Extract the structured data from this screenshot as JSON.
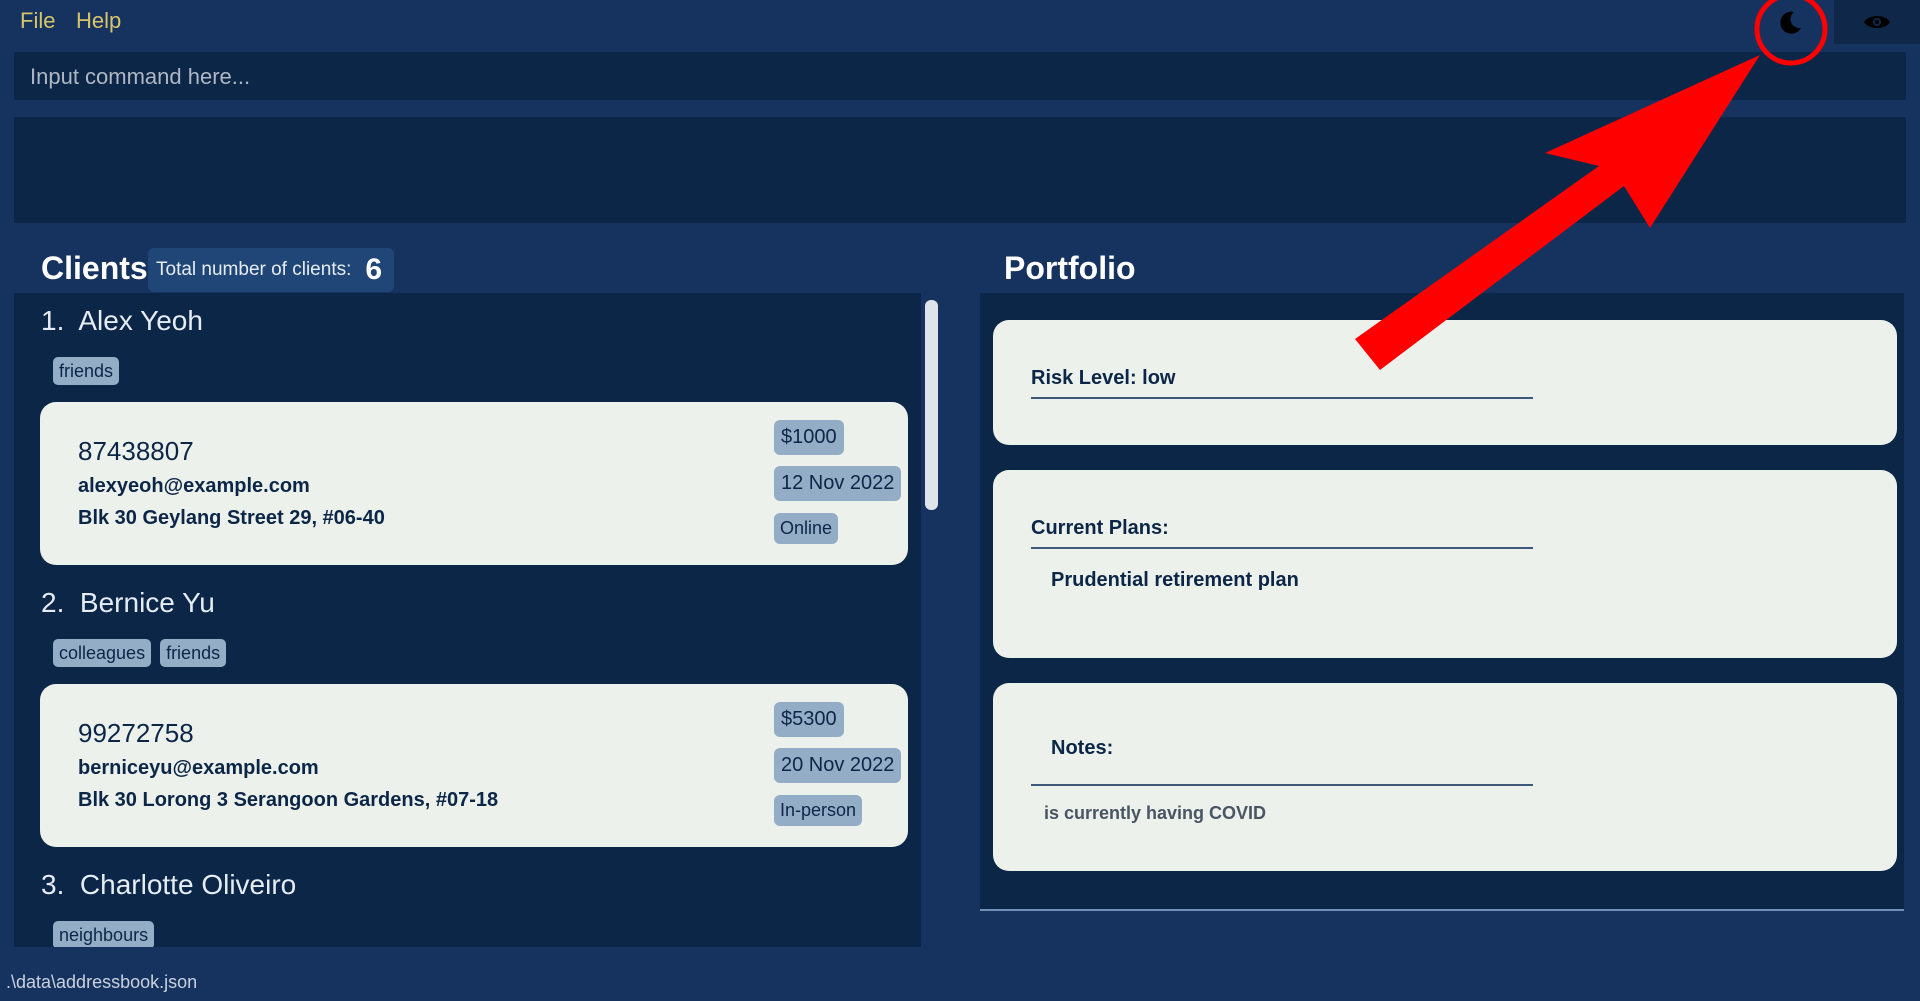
{
  "menu": {
    "file": "File",
    "help": "Help"
  },
  "toolbar": {
    "theme_icon": "moon-icon",
    "eye_icon": "eye-icon"
  },
  "command": {
    "placeholder": "Input command here..."
  },
  "clients": {
    "title": "Clients",
    "count_label": "Total number of clients:",
    "count": "6",
    "items": [
      {
        "index": "1.",
        "name": "Alex Yeoh",
        "tags": [
          "friends"
        ],
        "phone": "87438807",
        "email": "alexyeoh@example.com",
        "address": "Blk 30 Geylang Street 29, #06-40",
        "amount": "$1000",
        "date": "12 Nov 2022",
        "mode": "Online"
      },
      {
        "index": "2.",
        "name": "Bernice Yu",
        "tags": [
          "colleagues",
          "friends"
        ],
        "phone": "99272758",
        "email": "berniceyu@example.com",
        "address": "Blk 30 Lorong 3 Serangoon Gardens, #07-18",
        "amount": "$5300",
        "date": "20 Nov 2022",
        "mode": "In-person"
      },
      {
        "index": "3.",
        "name": "Charlotte Oliveiro",
        "tags": [
          "neighbours"
        ]
      }
    ]
  },
  "portfolio": {
    "title": "Portfolio",
    "risk_label": "Risk Level: low",
    "plans_label": "Current Plans:",
    "plans_value": "Prudential retirement plan",
    "notes_label": "Notes:",
    "notes_value": "is currently having COVID"
  },
  "status": {
    "path": ".\\data\\addressbook.json"
  },
  "colors": {
    "background": "#16325f",
    "panel": "#0c2647",
    "card": "#ecf1ec",
    "tag": "#94adc6",
    "menu_text": "#d7c46a",
    "annotation": "#ff0000"
  }
}
